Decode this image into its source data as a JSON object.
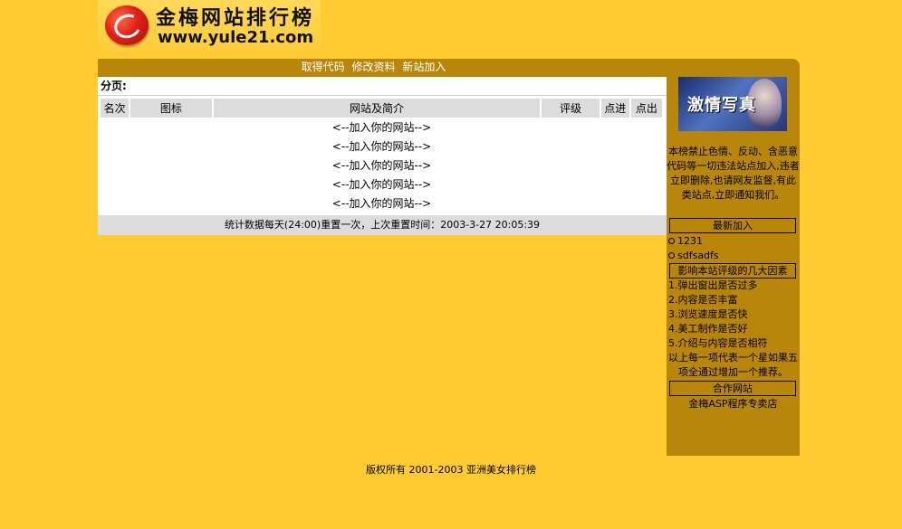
{
  "header": {
    "site_title": "金梅网站排行榜",
    "site_url": "www.yule21.com"
  },
  "nav": {
    "links": [
      "取得代码",
      "修改资料",
      "新站加入"
    ]
  },
  "main": {
    "pager_label": "分页:",
    "columns": [
      "名次",
      "图标",
      "网站及简介",
      "评级",
      "点进",
      "点出"
    ],
    "rows": [
      "<--加入你的网站-->",
      "<--加入你的网站-->",
      "<--加入你的网站-->",
      "<--加入你的网站-->",
      "<--加入你的网站-->"
    ],
    "stats": "统计数据每天(24:00)重置一次，上次重置时间：2003-3-27 20:05:39"
  },
  "sidebar": {
    "ad_text": "激情写真",
    "notice": "本榜禁止色情、反动、含恶意代码等一切违法站点加入,违者立即删除,也请网友监督,有此类站点,立即通知我们。",
    "latest_header": "最新加入",
    "latest_items": [
      "1231",
      "sdfsadfs"
    ],
    "factors_header": "影响本站评级的几大因素",
    "factors": [
      "1.弹出窗出是否过多",
      "2.内容是否丰富",
      "3.浏览速度是否快",
      "4.美工制作是否好",
      "5.介绍与内容是否相符"
    ],
    "factors_note": "以上每一项代表一个星如果五项全通过增加一个推荐。",
    "partners_header": "合作网站",
    "partner_link": "金梅ASP程序专卖店"
  },
  "footer": {
    "text": "版权所有 2001-2003 亚洲美女排行榜"
  }
}
